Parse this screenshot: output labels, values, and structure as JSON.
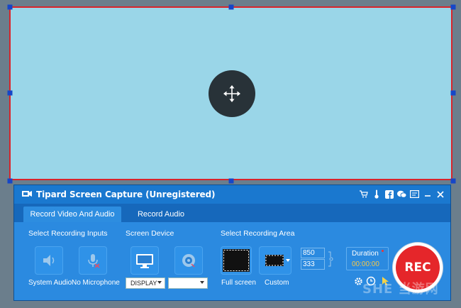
{
  "window": {
    "title": "Tipard Screen Capture (Unregistered)"
  },
  "titlebar_icons": [
    "cart-icon",
    "thermometer-icon",
    "facebook-icon",
    "chat-icon",
    "feedback-icon",
    "minimize-icon",
    "close-icon"
  ],
  "tabs": [
    {
      "label": "Record Video And Audio",
      "active": true
    },
    {
      "label": "Record Audio",
      "active": false
    }
  ],
  "sections": {
    "inputs": "Select Recording Inputs",
    "device": "Screen Device",
    "area": "Select Recording Area"
  },
  "inputs": {
    "system_audio": "System Audio",
    "no_microphone": "No Microphone"
  },
  "device": {
    "display_select": "DISPLAY",
    "second_select": ""
  },
  "area": {
    "full_screen": "Full screen",
    "custom": "Custom",
    "width": "850",
    "height": "333"
  },
  "duration": {
    "label": "Duration",
    "time": "00:00:00"
  },
  "rec_label": "REC",
  "watermark": "SHE 当游网",
  "colors": {
    "region_bg": "#9ad6e8",
    "region_border": "#d9242b",
    "rec": "#e5262a",
    "panel": "#2b8ae0"
  }
}
